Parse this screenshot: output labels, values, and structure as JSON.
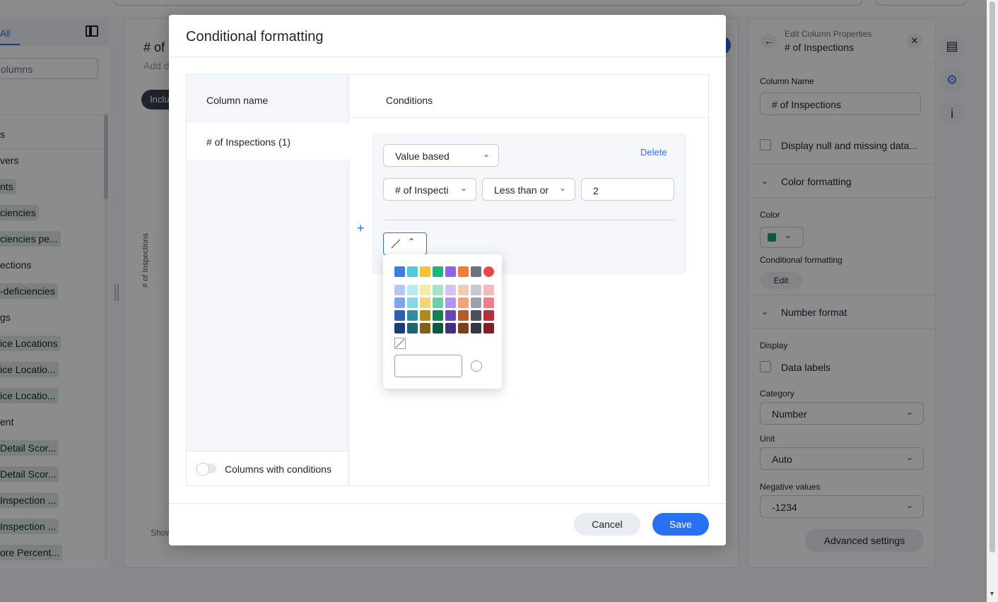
{
  "background": {
    "left_panel": {
      "tab_all": "All",
      "search_placeholder": "olumns",
      "items": [
        "s",
        "vers",
        "nts",
        "ciencies",
        "ciencies pe...",
        "ections",
        "-deficiencies",
        "gs",
        "ice Locations",
        "ice Locatio...",
        "ice Locatio...",
        "ent",
        "Detail Scor...",
        "Detail Scor...",
        "Inspection ...",
        "Inspection ...",
        "ore Percent..."
      ]
    },
    "center": {
      "title": "# of",
      "subtitle": "Add d",
      "chip": "Inclu",
      "axis_label": "# of Inspections",
      "show": "Show"
    },
    "right_panel": {
      "header_sub": "Edit Column Properties",
      "header_title": "# of Inspections",
      "column_name_label": "Column Name",
      "column_name_value": "# of Inspections",
      "display_null_label": "Display null and missing data...",
      "color_formatting": "Color formatting",
      "color_label": "Color",
      "conditional_formatting_label": "Conditional formatting",
      "edit_label": "Edit",
      "number_format": "Number format",
      "display_label": "Display",
      "data_labels": "Data labels",
      "category_label": "Category",
      "category_value": "Number",
      "unit_label": "Unit",
      "unit_value": "Auto",
      "negative_label": "Negative values",
      "negative_value": "-1234",
      "advanced_settings": "Advanced settings"
    },
    "rail_icons": [
      "bar-chart-icon",
      "gear-icon",
      "info-icon"
    ]
  },
  "modal": {
    "title": "Conditional formatting",
    "column_header": "Column name",
    "conditions_header": "Conditions",
    "column_item": "# of Inspections (1)",
    "columns_with_conditions": "Columns with conditions",
    "condition": {
      "type": "Value based",
      "delete": "Delete",
      "column": "# of Inspecti",
      "operator": "Less than or",
      "value": "2"
    },
    "palette": {
      "primary": [
        "#3b7de0",
        "#4ccbe0",
        "#f2c237",
        "#1fb581",
        "#8e63e8",
        "#ef7d3c",
        "#6c737d",
        "#e8464e"
      ],
      "rows": [
        [
          "#b4c9f2",
          "#b6e9f1",
          "#f8e8b0",
          "#a9e2cb",
          "#d3c3f5",
          "#f6c9b2",
          "#c5c9ce",
          "#f4b9bd"
        ],
        [
          "#7fa6ea",
          "#84d9e8",
          "#f4d578",
          "#6ccfa6",
          "#b294f0",
          "#f2a37a",
          "#9ca2ab",
          "#ef7f86"
        ],
        [
          "#2f5fb2",
          "#2e8fa0",
          "#b08a1c",
          "#198055",
          "#6a44b8",
          "#b55a28",
          "#4a4f58",
          "#b43038"
        ],
        [
          "#1c3d7a",
          "#1f6470",
          "#7d6114",
          "#0f5a3b",
          "#472d80",
          "#7e3f1b",
          "#343840",
          "#7e2027"
        ]
      ]
    },
    "cancel": "Cancel",
    "save": "Save"
  }
}
